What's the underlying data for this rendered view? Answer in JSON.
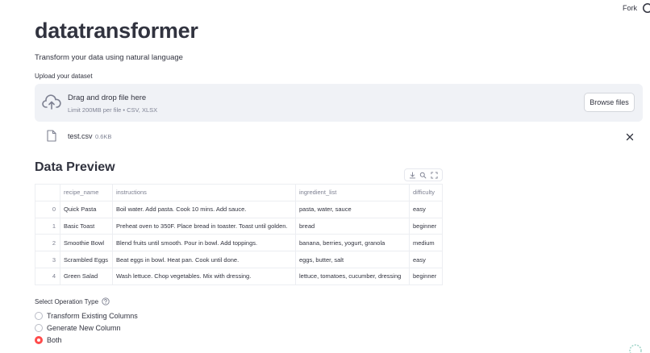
{
  "header": {
    "fork_label": "Fork",
    "github_icon": "github-icon"
  },
  "app": {
    "title": "datatransformer",
    "subtitle": "Transform your data using natural language"
  },
  "upload": {
    "label": "Upload your dataset",
    "dropzone_title": "Drag and drop file here",
    "dropzone_limit": "Limit 200MB per file • CSV, XLSX",
    "browse_label": "Browse files",
    "icon": "cloud-upload-icon"
  },
  "file": {
    "name": "test.csv",
    "size": "0.6KB"
  },
  "preview": {
    "title": "Data Preview",
    "columns": [
      "",
      "recipe_name",
      "instructions",
      "ingredient_list",
      "difficulty"
    ],
    "rows": [
      [
        "0",
        "Quick Pasta",
        "Boil water. Add pasta. Cook 10 mins. Add sauce.",
        "pasta, water, sauce",
        "easy"
      ],
      [
        "1",
        "Basic Toast",
        "Preheat oven to 350F. Place bread in toaster. Toast until golden.",
        "bread",
        "beginner"
      ],
      [
        "2",
        "Smoothie Bowl",
        "Blend fruits until smooth. Pour in bowl. Add toppings.",
        "banana, berries, yogurt, granola",
        "medium"
      ],
      [
        "3",
        "Scrambled Eggs",
        "Beat eggs in bowl. Heat pan. Cook until done.",
        "eggs, butter, salt",
        "easy"
      ],
      [
        "4",
        "Green Salad",
        "Wash lettuce. Chop vegetables. Mix with dressing.",
        "lettuce, tomatoes, cucumber, dressing",
        "beginner"
      ]
    ]
  },
  "operation": {
    "label": "Select Operation Type",
    "options": [
      "Transform Existing Columns",
      "Generate New Column",
      "Both"
    ],
    "selected": "Both"
  },
  "colors": {
    "accent": "#ff4b4b",
    "dropzone_bg": "#f0f2f6",
    "text": "#31333f",
    "muted": "#808495"
  }
}
